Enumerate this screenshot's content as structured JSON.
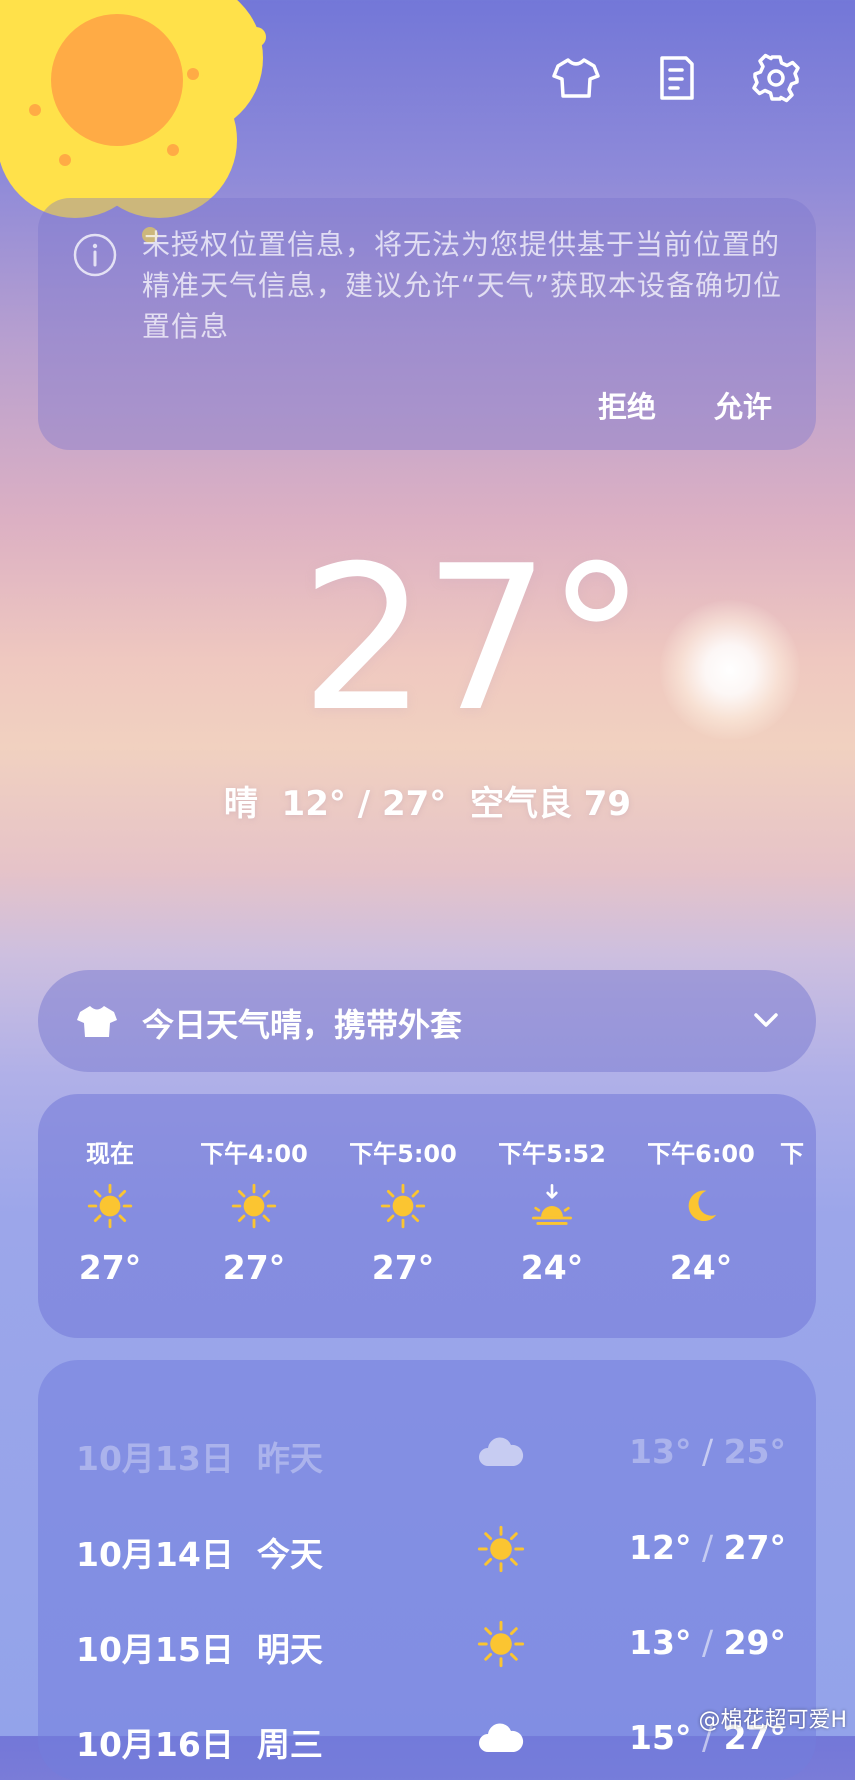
{
  "topbar": {
    "icons": [
      "shirt-icon",
      "document-icon",
      "gear-icon"
    ]
  },
  "notice": {
    "message": "未授权位置信息，将无法为您提供基于当前位置的精准天气信息，建议允许“天气”获取本设备确切位置信息",
    "reject_label": "拒绝",
    "allow_label": "允许"
  },
  "current": {
    "temperature": "27°",
    "summary": "晴  12° / 27°  空气良 79"
  },
  "tip": {
    "text": "今日天气晴，携带外套"
  },
  "hourly": [
    {
      "time": "现在",
      "icon": "sun-icon",
      "temp": "27°"
    },
    {
      "time": "下午4:00",
      "icon": "sun-icon",
      "temp": "27°"
    },
    {
      "time": "下午5:00",
      "icon": "sun-icon",
      "temp": "27°"
    },
    {
      "time": "下午5:52",
      "icon": "sunset-icon",
      "temp": "24°"
    },
    {
      "time": "下午6:00",
      "icon": "moon-icon",
      "temp": "24°"
    },
    {
      "time": "下",
      "icon": "",
      "temp": ""
    }
  ],
  "daily": [
    {
      "date": "10月13日  昨天",
      "icon": "cloud-icon",
      "low": "13°",
      "high": "25°",
      "faded": true
    },
    {
      "date": "10月14日  今天",
      "icon": "sun-icon",
      "low": "12°",
      "high": "27°",
      "faded": false
    },
    {
      "date": "10月15日  明天",
      "icon": "sun-icon",
      "low": "13°",
      "high": "29°",
      "faded": false
    },
    {
      "date": "10月16日  周三",
      "icon": "cloud-icon",
      "low": "15°",
      "high": "27°",
      "faded": false
    }
  ],
  "range_separator": "/",
  "watermark": "@棉花超可爱H",
  "colors": {
    "sun_yellow": "#fbc531",
    "flower_petal": "#ffe14a",
    "flower_center": "#ffab45"
  }
}
